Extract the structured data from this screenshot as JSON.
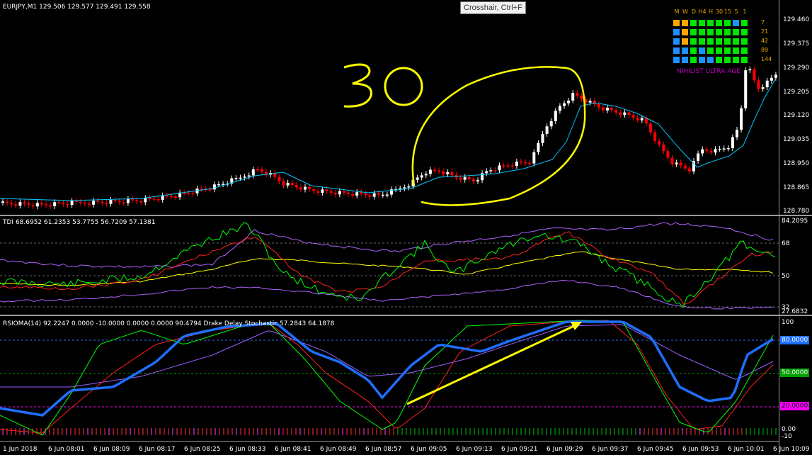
{
  "tooltip": "Crosshair, Ctrl+F",
  "main": {
    "title": "EURJPY,M1  129.506 129.577 129.491 129.558",
    "prices": [
      "129.460",
      "129.375",
      "129.290",
      "129.205",
      "129.120",
      "129.035",
      "128.950",
      "128.865",
      "128.780"
    ],
    "annotation_text": "30",
    "annotation_color": "#ffff00"
  },
  "tdi": {
    "title": "TDI 68.6952 61.2353 53.7755 56.7209 57.1381",
    "levels": [
      "84.2095",
      "68",
      "50",
      "32",
      "27.6832"
    ]
  },
  "rsioma": {
    "title": "RSIOMA(14) 92.2247 0.0000 -10.0000 0.0000 0.0000 90.4794  Drake Delay Stochastic 57.2843 64.1878",
    "levels": [
      "100",
      "80.0000",
      "50.0000",
      "20.0000",
      "0.00",
      "-10"
    ]
  },
  "xaxis": [
    "1 Jun 2018",
    "6 Jun 08:01",
    "6 Jun 08:09",
    "6 Jun 08:17",
    "6 Jun 08:25",
    "6 Jun 08:33",
    "6 Jun 08:41",
    "6 Jun 08:49",
    "6 Jun 08:57",
    "6 Jun 09:05",
    "6 Jun 09:13",
    "6 Jun 09:21",
    "6 Jun 09:29",
    "6 Jun 09:37",
    "6 Jun 09:45",
    "6 Jun 09:53",
    "6 Jun 10:01",
    "6 Jun 10:09"
  ],
  "matrix": {
    "headers": [
      "M",
      "W",
      "D",
      "H4",
      "H",
      "30",
      "15",
      "5",
      "1"
    ],
    "rows": [
      "7",
      "21",
      "42",
      "89",
      "144"
    ],
    "brand": "NIHILIST ULTRA AGE",
    "colors": {
      "orange": "#ffa500",
      "blue": "#1e90ff",
      "green": "#00e400"
    },
    "cells": [
      [
        "orange",
        "orange",
        "green",
        "green",
        "green",
        "green",
        "green",
        "blue",
        "green"
      ],
      [
        "blue",
        "orange",
        "green",
        "green",
        "green",
        "green",
        "green",
        "green",
        "green"
      ],
      [
        "blue",
        "orange",
        "green",
        "green",
        "green",
        "green",
        "green",
        "green",
        "green"
      ],
      [
        "blue",
        "blue",
        "green",
        "blue",
        "green",
        "green",
        "green",
        "green",
        "green"
      ],
      [
        "blue",
        "blue",
        "green",
        "blue",
        "blue",
        "green",
        "green",
        "green",
        "green"
      ]
    ]
  },
  "colors": {
    "bull": "#ffffff",
    "bear": "#ff0000",
    "ma": "#00c8ff",
    "green": "#00ff00",
    "red": "#ff2020",
    "yellow": "#ffff00",
    "violet": "#a050ff",
    "rsioma": "#1e6fff"
  }
}
